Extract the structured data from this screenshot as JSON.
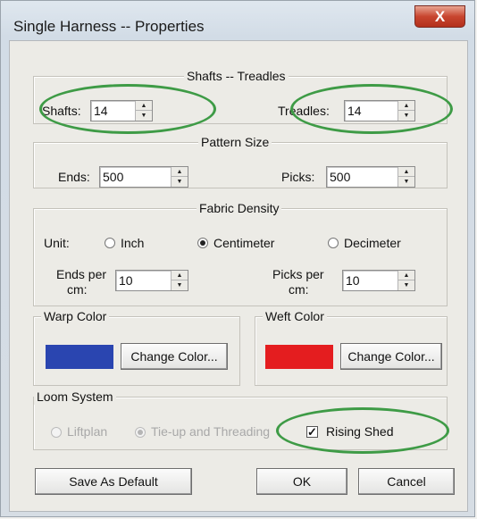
{
  "window": {
    "title": "Single Harness -- Properties",
    "close_glyph": "X"
  },
  "shafts_treadles": {
    "title": "Shafts -- Treadles",
    "shafts_label": "Shafts:",
    "shafts_value": "14",
    "treadles_label": "Treadles:",
    "treadles_value": "14"
  },
  "pattern_size": {
    "title": "Pattern Size",
    "ends_label": "Ends:",
    "ends_value": "500",
    "picks_label": "Picks:",
    "picks_value": "500"
  },
  "fabric_density": {
    "title": "Fabric Density",
    "unit_label": "Unit:",
    "units": [
      {
        "label": "Inch",
        "selected": false
      },
      {
        "label": "Centimeter",
        "selected": true
      },
      {
        "label": "Decimeter",
        "selected": false
      }
    ],
    "ends_per_label_1": "Ends per",
    "ends_per_label_2": "cm:",
    "ends_per_value": "10",
    "picks_per_label_1": "Picks per",
    "picks_per_label_2": "cm:",
    "picks_per_value": "10"
  },
  "warp_color": {
    "title": "Warp Color",
    "swatch": "#2a45b0",
    "button": "Change Color..."
  },
  "weft_color": {
    "title": "Weft Color",
    "swatch": "#e41d1f",
    "button": "Change Color..."
  },
  "loom_system": {
    "title": "Loom System",
    "liftplan_label": "Liftplan",
    "tieup_label": "Tie-up and Threading",
    "rising_shed_label": "Rising Shed",
    "rising_shed_checked": true
  },
  "footer": {
    "save_default": "Save As Default",
    "ok": "OK",
    "cancel": "Cancel"
  },
  "colors": {
    "highlight_ring": "#3e9b46"
  },
  "icons": {
    "spin_up": "▲",
    "spin_down": "▼",
    "check": "✓"
  }
}
